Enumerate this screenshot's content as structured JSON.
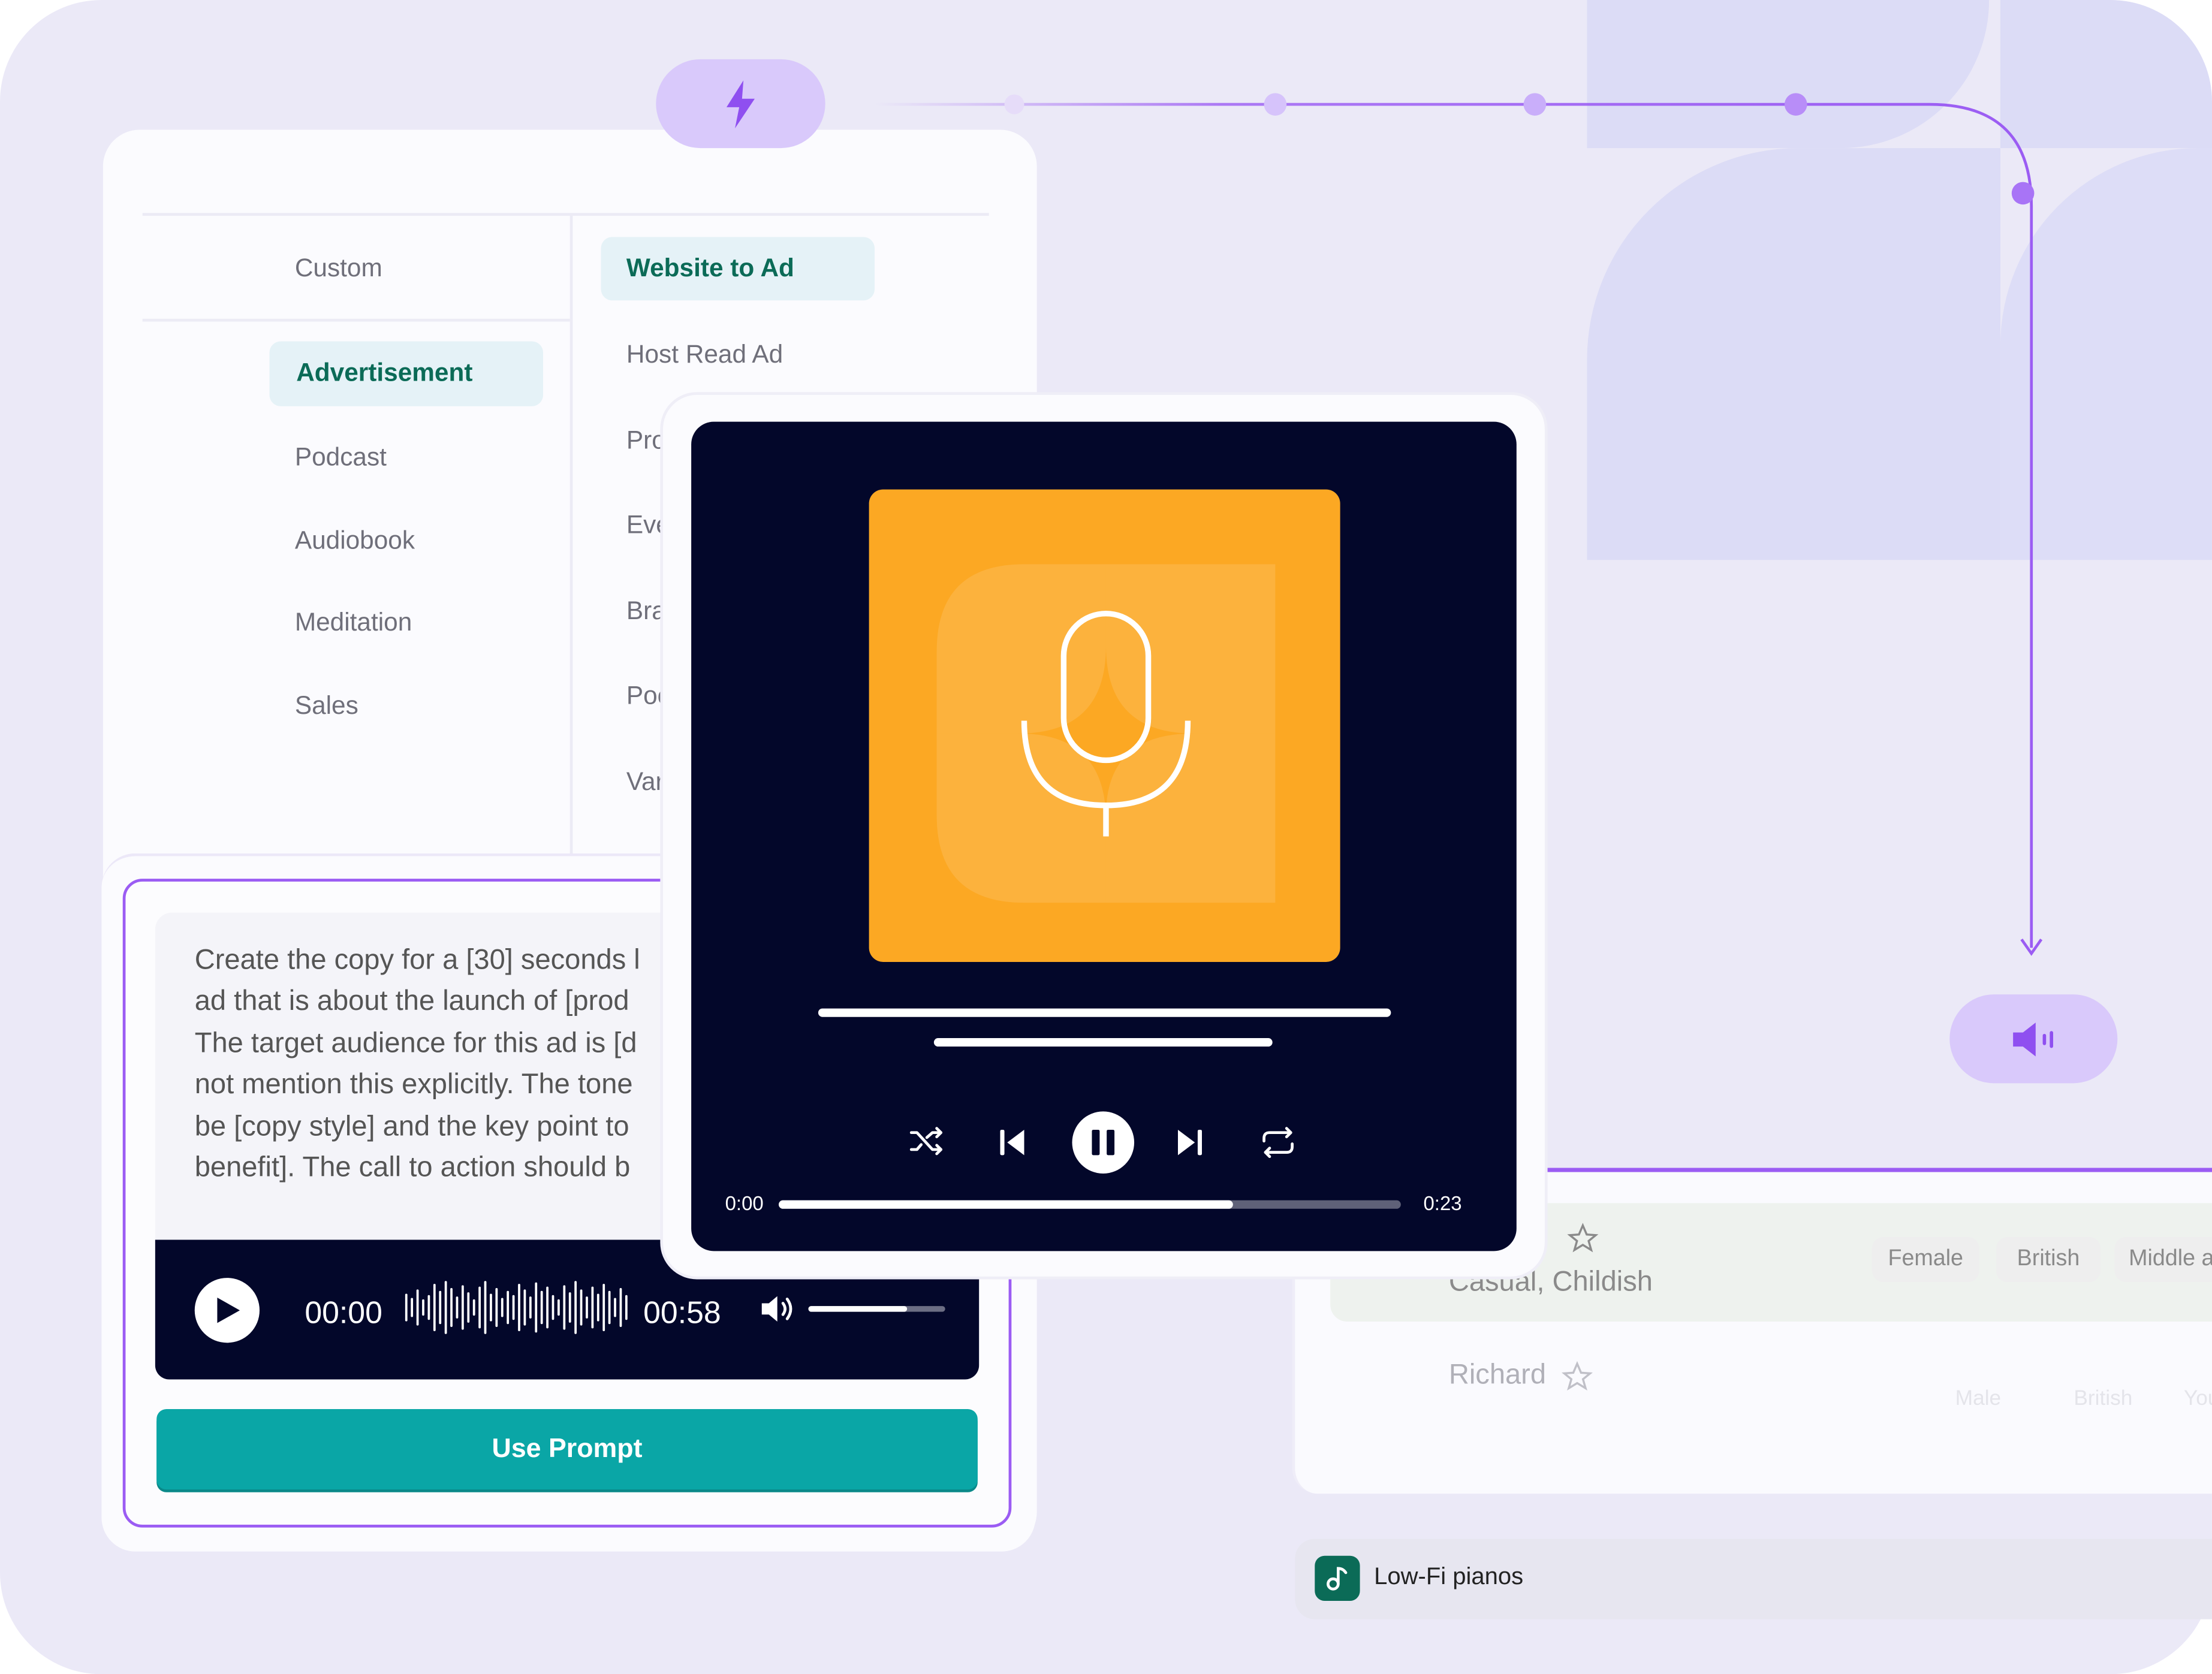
{
  "categories": [
    "Custom",
    "Advertisement",
    "Podcast",
    "Audiobook",
    "Meditation",
    "Sales"
  ],
  "templates": [
    "Website to Ad",
    "Host Read Ad",
    "Pro",
    "Eve",
    "Bra",
    "Poc",
    "Var"
  ],
  "prompt": {
    "lines": [
      "Create the copy for a [30] seconds l",
      "ad that is about the launch of [prod",
      "The target audience for this ad is [d",
      "not mention this explicitly. The tone",
      "be [copy style] and the key point to",
      "benefit]. The call to action should b"
    ],
    "time_start": "00:00",
    "time_end": "00:58",
    "volume_fraction": 0.72,
    "use_prompt_label": "Use Prompt"
  },
  "player": {
    "time_start": "0:00",
    "time_end": "0:23",
    "progress_fraction": 0.73
  },
  "voices": [
    {
      "name": "",
      "descriptor": "Casual, Childish",
      "tags": [
        "Female",
        "British",
        "Middle ag"
      ]
    },
    {
      "name": "Richard",
      "descriptor": "",
      "tags": [
        "Male",
        "British",
        "You"
      ]
    }
  ],
  "music": {
    "track": "Low-Fi pianos"
  },
  "colors": {
    "accent": "#9b5cf3",
    "teal": "#0aa6a6",
    "brand_green": "#0b6b57",
    "player_bg": "#03072a",
    "cover_orange": "#fca823"
  }
}
